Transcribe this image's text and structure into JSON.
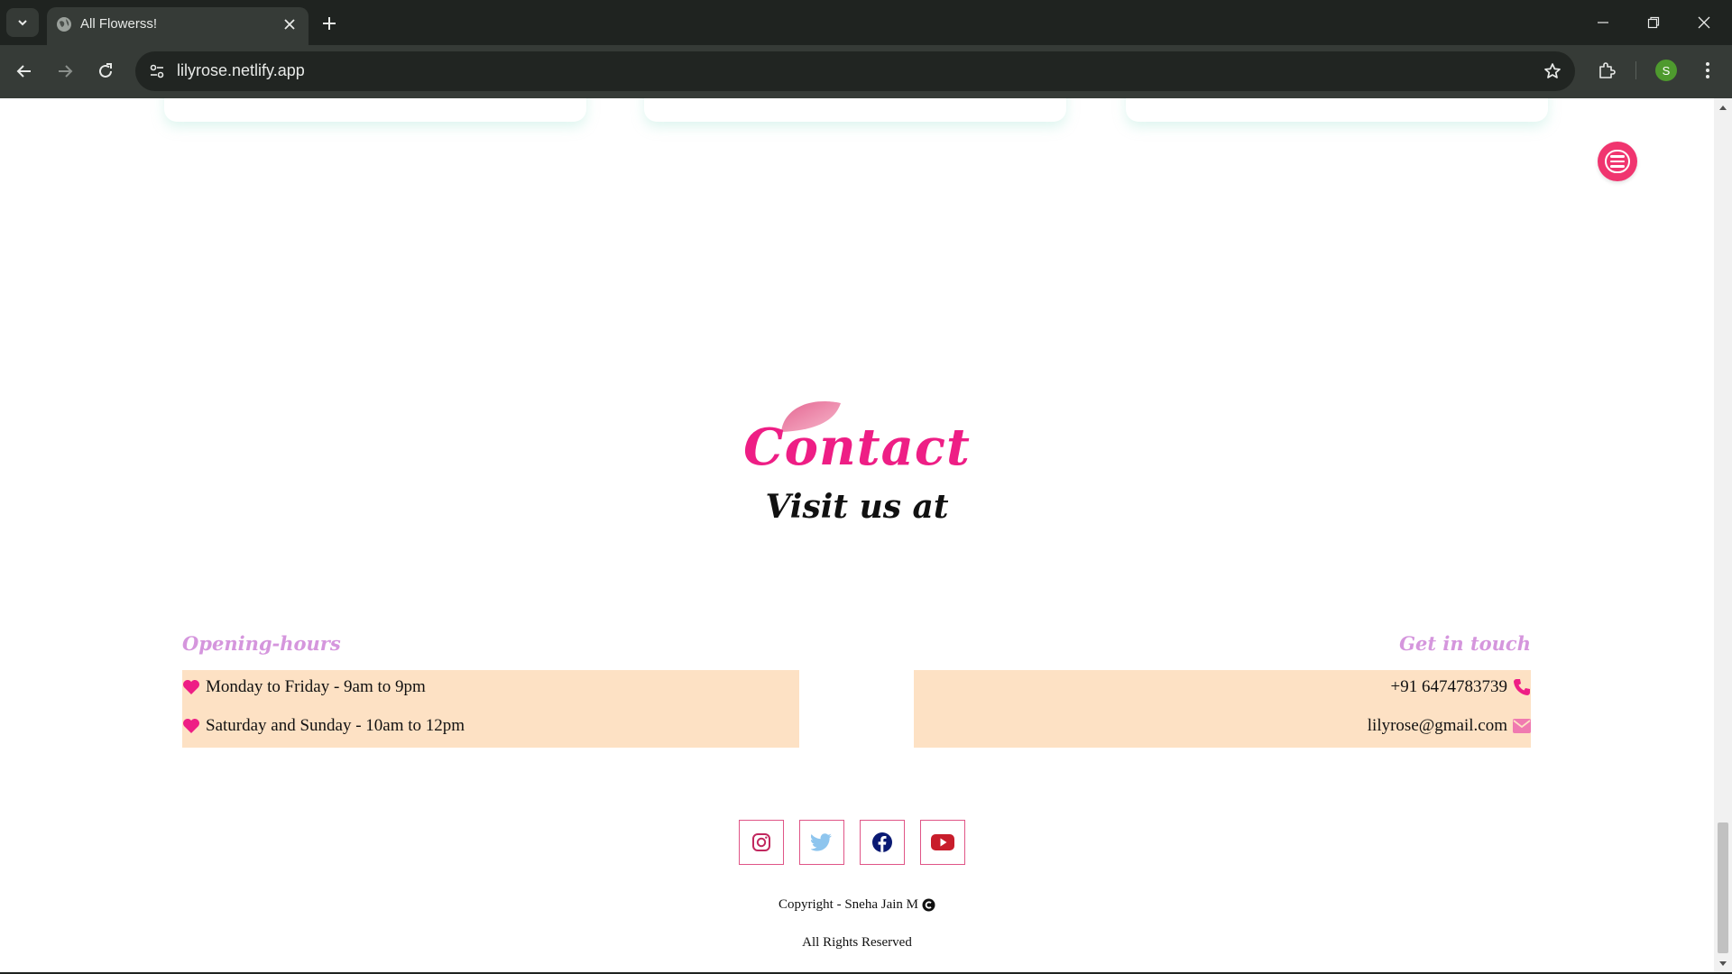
{
  "browser": {
    "tab_title": "All Flowerss!",
    "url": "lilyrose.netlify.app",
    "profile_initial": "S",
    "icons": [
      "tab-search-icon",
      "globe-icon",
      "close-icon",
      "plus-icon",
      "back-icon",
      "forward-icon",
      "reload-icon",
      "site-settings-icon",
      "star-icon",
      "extensions-icon",
      "more-vert-icon",
      "minimize-icon",
      "restore-icon"
    ]
  },
  "page": {
    "contact_title": "Contact",
    "subtitle": "Visit us at",
    "opening_hours": {
      "heading": "Opening-hours",
      "lines": [
        "Monday to Friday - 9am to 9pm",
        "Saturday and Sunday - 10am to 12pm"
      ]
    },
    "get_in_touch": {
      "heading": "Get in touch",
      "phone": "+91 6474783739",
      "email": "lilyrose@gmail.com"
    },
    "socials": [
      "instagram-icon",
      "twitter-icon",
      "facebook-icon",
      "youtube-icon"
    ],
    "copyright": "Copyright - Sneha Jain M",
    "rights": "All Rights Reserved",
    "colors": {
      "accent_pink": "#ee1e85",
      "heading_lilac": "#d596dd",
      "box_peach": "#fde1c4",
      "hamburger": "#f0356f"
    }
  }
}
